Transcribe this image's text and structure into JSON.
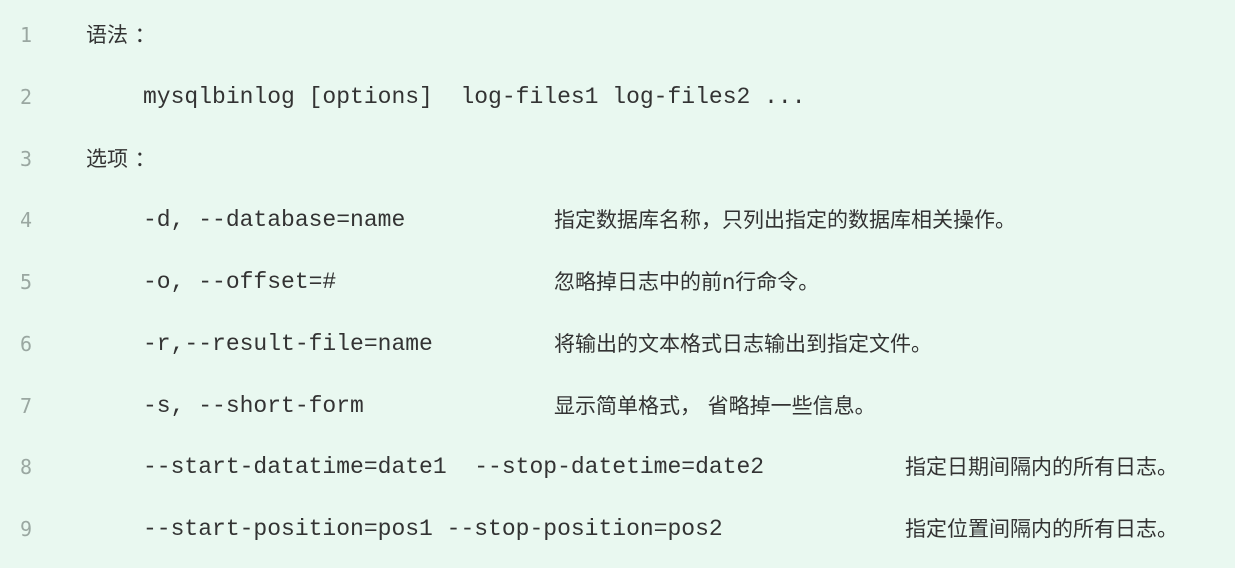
{
  "code_block": {
    "lines": [
      {
        "number": "1",
        "segments": [
          "语法 ："
        ]
      },
      {
        "number": "2",
        "segments": [
          "mysqlbinlog [options]  log-files1 log-files2 ..."
        ]
      },
      {
        "number": "3",
        "segments": [
          "选项 ："
        ]
      },
      {
        "number": "4",
        "segments": [
          "-d, --database=name",
          "指定数据库名称，只列出指定的数据库相关操作。"
        ]
      },
      {
        "number": "5",
        "segments": [
          "-o, --offset=#",
          "忽略掉日志中的前n行命令。"
        ]
      },
      {
        "number": "6",
        "segments": [
          "-r,--result-file=name",
          "将输出的文本格式日志输出到指定文件。"
        ]
      },
      {
        "number": "7",
        "segments": [
          "-s, --short-form",
          "显示简单格式， 省略掉一些信息。"
        ]
      },
      {
        "number": "8",
        "segments": [
          "--start-datatime=date1  --stop-datetime=date2",
          "指定日期间隔内的所有日志。"
        ]
      },
      {
        "number": "9",
        "segments": [
          "--start-position=pos1 --stop-position=pos2",
          "指定位置间隔内的所有日志。"
        ]
      }
    ]
  }
}
